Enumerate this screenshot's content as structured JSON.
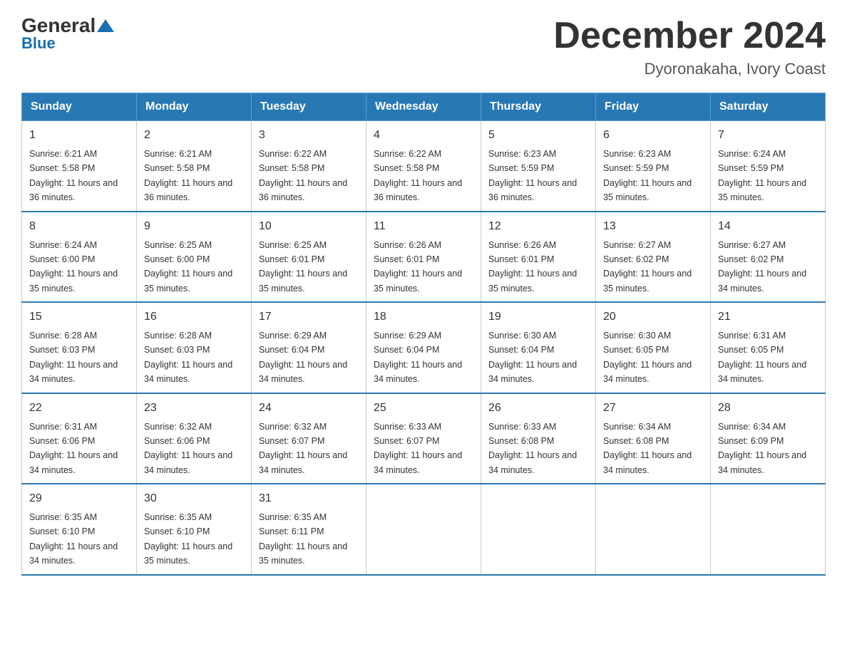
{
  "logo": {
    "general": "General",
    "blue": "Blue"
  },
  "header": {
    "title": "December 2024",
    "subtitle": "Dyoronakaha, Ivory Coast"
  },
  "weekdays": [
    "Sunday",
    "Monday",
    "Tuesday",
    "Wednesday",
    "Thursday",
    "Friday",
    "Saturday"
  ],
  "weeks": [
    [
      {
        "day": "1",
        "sunrise": "6:21 AM",
        "sunset": "5:58 PM",
        "daylight": "11 hours and 36 minutes."
      },
      {
        "day": "2",
        "sunrise": "6:21 AM",
        "sunset": "5:58 PM",
        "daylight": "11 hours and 36 minutes."
      },
      {
        "day": "3",
        "sunrise": "6:22 AM",
        "sunset": "5:58 PM",
        "daylight": "11 hours and 36 minutes."
      },
      {
        "day": "4",
        "sunrise": "6:22 AM",
        "sunset": "5:58 PM",
        "daylight": "11 hours and 36 minutes."
      },
      {
        "day": "5",
        "sunrise": "6:23 AM",
        "sunset": "5:59 PM",
        "daylight": "11 hours and 36 minutes."
      },
      {
        "day": "6",
        "sunrise": "6:23 AM",
        "sunset": "5:59 PM",
        "daylight": "11 hours and 35 minutes."
      },
      {
        "day": "7",
        "sunrise": "6:24 AM",
        "sunset": "5:59 PM",
        "daylight": "11 hours and 35 minutes."
      }
    ],
    [
      {
        "day": "8",
        "sunrise": "6:24 AM",
        "sunset": "6:00 PM",
        "daylight": "11 hours and 35 minutes."
      },
      {
        "day": "9",
        "sunrise": "6:25 AM",
        "sunset": "6:00 PM",
        "daylight": "11 hours and 35 minutes."
      },
      {
        "day": "10",
        "sunrise": "6:25 AM",
        "sunset": "6:01 PM",
        "daylight": "11 hours and 35 minutes."
      },
      {
        "day": "11",
        "sunrise": "6:26 AM",
        "sunset": "6:01 PM",
        "daylight": "11 hours and 35 minutes."
      },
      {
        "day": "12",
        "sunrise": "6:26 AM",
        "sunset": "6:01 PM",
        "daylight": "11 hours and 35 minutes."
      },
      {
        "day": "13",
        "sunrise": "6:27 AM",
        "sunset": "6:02 PM",
        "daylight": "11 hours and 35 minutes."
      },
      {
        "day": "14",
        "sunrise": "6:27 AM",
        "sunset": "6:02 PM",
        "daylight": "11 hours and 34 minutes."
      }
    ],
    [
      {
        "day": "15",
        "sunrise": "6:28 AM",
        "sunset": "6:03 PM",
        "daylight": "11 hours and 34 minutes."
      },
      {
        "day": "16",
        "sunrise": "6:28 AM",
        "sunset": "6:03 PM",
        "daylight": "11 hours and 34 minutes."
      },
      {
        "day": "17",
        "sunrise": "6:29 AM",
        "sunset": "6:04 PM",
        "daylight": "11 hours and 34 minutes."
      },
      {
        "day": "18",
        "sunrise": "6:29 AM",
        "sunset": "6:04 PM",
        "daylight": "11 hours and 34 minutes."
      },
      {
        "day": "19",
        "sunrise": "6:30 AM",
        "sunset": "6:04 PM",
        "daylight": "11 hours and 34 minutes."
      },
      {
        "day": "20",
        "sunrise": "6:30 AM",
        "sunset": "6:05 PM",
        "daylight": "11 hours and 34 minutes."
      },
      {
        "day": "21",
        "sunrise": "6:31 AM",
        "sunset": "6:05 PM",
        "daylight": "11 hours and 34 minutes."
      }
    ],
    [
      {
        "day": "22",
        "sunrise": "6:31 AM",
        "sunset": "6:06 PM",
        "daylight": "11 hours and 34 minutes."
      },
      {
        "day": "23",
        "sunrise": "6:32 AM",
        "sunset": "6:06 PM",
        "daylight": "11 hours and 34 minutes."
      },
      {
        "day": "24",
        "sunrise": "6:32 AM",
        "sunset": "6:07 PM",
        "daylight": "11 hours and 34 minutes."
      },
      {
        "day": "25",
        "sunrise": "6:33 AM",
        "sunset": "6:07 PM",
        "daylight": "11 hours and 34 minutes."
      },
      {
        "day": "26",
        "sunrise": "6:33 AM",
        "sunset": "6:08 PM",
        "daylight": "11 hours and 34 minutes."
      },
      {
        "day": "27",
        "sunrise": "6:34 AM",
        "sunset": "6:08 PM",
        "daylight": "11 hours and 34 minutes."
      },
      {
        "day": "28",
        "sunrise": "6:34 AM",
        "sunset": "6:09 PM",
        "daylight": "11 hours and 34 minutes."
      }
    ],
    [
      {
        "day": "29",
        "sunrise": "6:35 AM",
        "sunset": "6:10 PM",
        "daylight": "11 hours and 34 minutes."
      },
      {
        "day": "30",
        "sunrise": "6:35 AM",
        "sunset": "6:10 PM",
        "daylight": "11 hours and 35 minutes."
      },
      {
        "day": "31",
        "sunrise": "6:35 AM",
        "sunset": "6:11 PM",
        "daylight": "11 hours and 35 minutes."
      },
      null,
      null,
      null,
      null
    ]
  ],
  "labels": {
    "sunrise": "Sunrise: ",
    "sunset": "Sunset: ",
    "daylight": "Daylight: "
  }
}
